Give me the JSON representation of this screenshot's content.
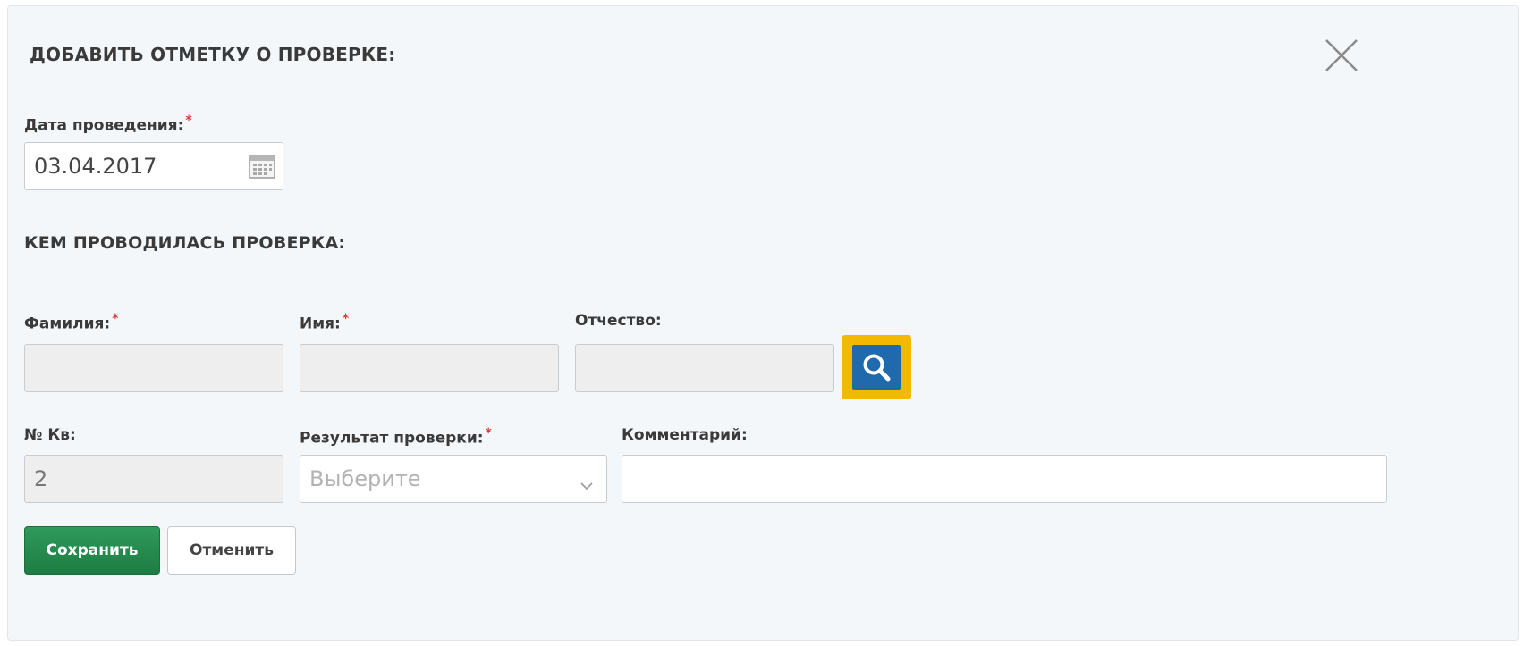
{
  "dialog": {
    "title": "ДОБАВИТЬ ОТМЕТКУ О ПРОВЕРКЕ:",
    "close_icon": "close-icon"
  },
  "date": {
    "label": "Дата проведения:",
    "required_mark": "*",
    "value": "03.04.2017",
    "icon": "calendar-icon"
  },
  "inspector": {
    "section_title": "КЕМ ПРОВОДИЛАСЬ ПРОВЕРКА:",
    "last_name_label": "Фамилия:",
    "first_name_label": "Имя:",
    "patronymic_label": "Отчество:",
    "required_mark": "*",
    "last_name_value": "",
    "first_name_value": "",
    "patronymic_value": "",
    "search_icon": "search-icon"
  },
  "details": {
    "apartment_label": "№ Кв:",
    "apartment_value": "2",
    "result_label": "Результат проверки:",
    "result_required_mark": "*",
    "result_placeholder": "Выберите",
    "comment_label": "Комментарий:",
    "comment_value": ""
  },
  "actions": {
    "save_label": "Сохранить",
    "cancel_label": "Отменить"
  },
  "colors": {
    "save_button": "#23884c",
    "search_button": "#1f69ad",
    "highlight": "#f5b800",
    "required": "#d63a3a"
  }
}
